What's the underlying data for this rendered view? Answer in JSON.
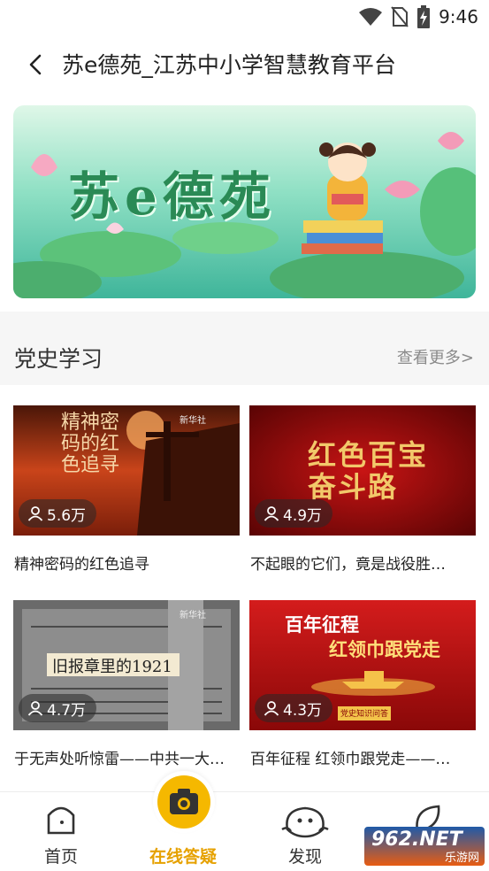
{
  "status_bar": {
    "time": "9:46",
    "icons": [
      "wifi-icon",
      "no-sim-icon",
      "battery-charging-icon"
    ]
  },
  "nav": {
    "title": "苏e德苑_江苏中小学智慧教育平台",
    "back_icon": "chevron-left-icon"
  },
  "banner": {
    "title": "苏e德苑"
  },
  "section": {
    "title": "党史学习",
    "more_label": "查看更多>"
  },
  "cards": [
    {
      "title": "精神密码的红色追寻",
      "views": "5.6万",
      "thumb_text": "精神密码的红色追寻",
      "thumb_badge": "新华社"
    },
    {
      "title": "不起眼的它们，竟是战役胜…",
      "views": "4.9万",
      "thumb_text": "红色百宝奋斗路"
    },
    {
      "title": "于无声处听惊雷——中共一大…",
      "views": "4.7万",
      "thumb_text": "旧报章里的1921",
      "thumb_badge": "新华社"
    },
    {
      "title": "百年征程 红领巾跟党走——…",
      "views": "4.3万",
      "thumb_line1": "百年征程",
      "thumb_line2": "红领巾跟党走",
      "thumb_tag": "党史知识问答"
    }
  ],
  "tabbar": {
    "tabs": [
      {
        "label": "首页",
        "icon": "home-icon"
      },
      {
        "label": "在线答疑",
        "icon": "camera-icon",
        "active": true
      },
      {
        "label": "发现",
        "icon": "discover-face-icon"
      },
      {
        "label": "",
        "icon": "leaf-icon"
      }
    ]
  },
  "watermark": {
    "text": "962.NET",
    "subtext": "乐游网"
  },
  "colors": {
    "accent": "#f5b800",
    "active_tab_text": "#e6a100",
    "banner_green": "#2a8a55"
  }
}
